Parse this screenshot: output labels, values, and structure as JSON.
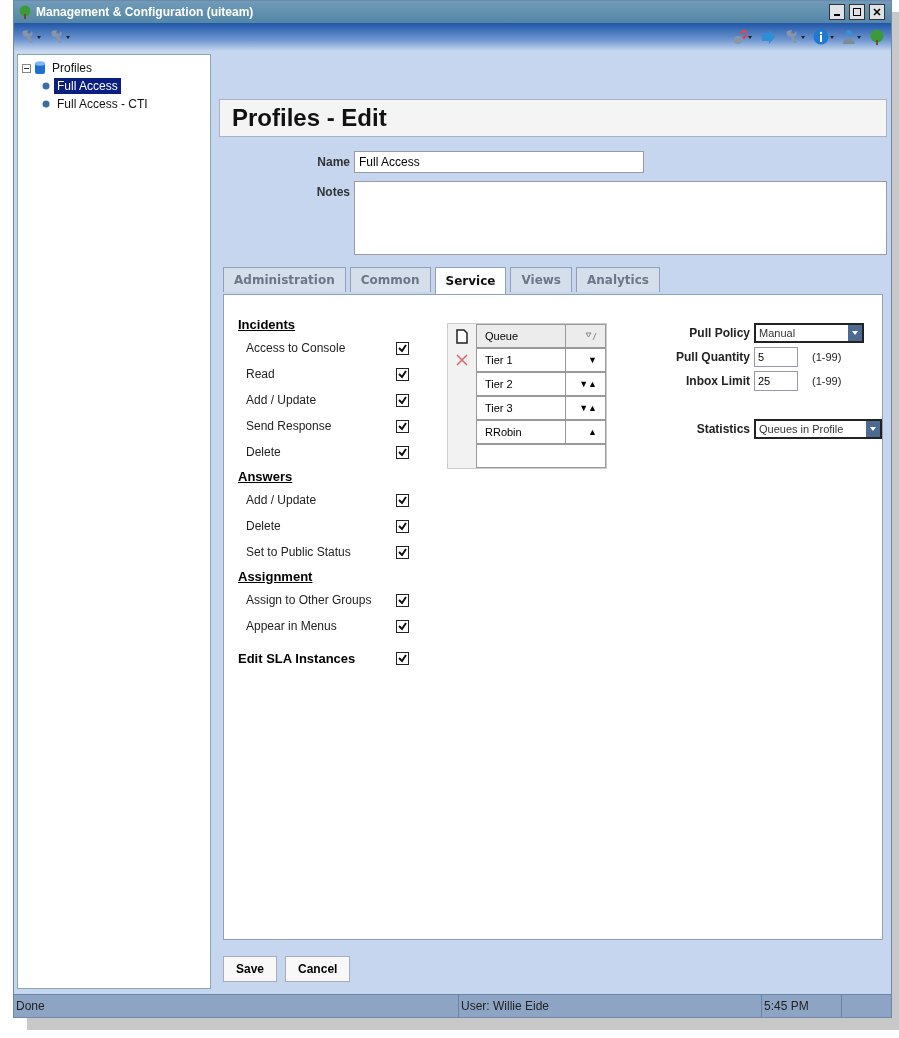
{
  "window": {
    "title": "Management & Configuration (uiteam)"
  },
  "tree": {
    "label": "Profiles",
    "expanded": true,
    "children": [
      {
        "label": "Full Access",
        "selected": true
      },
      {
        "label": "Full Access - CTI",
        "selected": false
      }
    ]
  },
  "page_title": "Profiles - Edit",
  "form": {
    "name_label": "Name",
    "name_value": "Full Access",
    "notes_label": "Notes"
  },
  "tabs": [
    {
      "label": "Administration",
      "selected": false
    },
    {
      "label": "Common",
      "selected": false
    },
    {
      "label": "Service",
      "selected": true
    },
    {
      "label": "Views",
      "selected": false
    },
    {
      "label": "Analytics",
      "selected": false
    }
  ],
  "permissions": [
    {
      "kind": "heading",
      "label": "Incidents"
    },
    {
      "kind": "checkbox",
      "label": "Access to Console",
      "checked": true
    },
    {
      "kind": "checkbox",
      "label": "Read",
      "checked": true
    },
    {
      "kind": "checkbox",
      "label": "Add / Update",
      "checked": true
    },
    {
      "kind": "checkbox",
      "label": "Send Response",
      "checked": true
    },
    {
      "kind": "checkbox",
      "label": "Delete",
      "checked": true
    },
    {
      "kind": "heading",
      "label": "Answers"
    },
    {
      "kind": "checkbox",
      "label": "Add / Update",
      "checked": true
    },
    {
      "kind": "checkbox",
      "label": "Delete",
      "checked": true
    },
    {
      "kind": "checkbox",
      "label": "Set to Public Status",
      "checked": true
    },
    {
      "kind": "heading",
      "label": "Assignment"
    },
    {
      "kind": "checkbox",
      "label": "Assign to Other Groups",
      "checked": true
    },
    {
      "kind": "checkbox",
      "label": "Appear in Menus",
      "checked": true
    },
    {
      "kind": "bold_checkbox",
      "label": "Edit SLA Instances",
      "checked": true
    }
  ],
  "queues": {
    "column": "Queue",
    "rows": [
      {
        "name": "Tier 1",
        "arrows": "▼"
      },
      {
        "name": "Tier 2",
        "arrows": "▼▲"
      },
      {
        "name": "Tier 3",
        "arrows": "▼▲"
      },
      {
        "name": "RRobin",
        "arrows": "▲"
      }
    ]
  },
  "settings": [
    {
      "kind": "select",
      "label": "Pull Policy",
      "value": "Manual"
    },
    {
      "kind": "number",
      "label": "Pull Quantity",
      "value": "5",
      "range": "(1-99)"
    },
    {
      "kind": "number",
      "label": "Inbox Limit",
      "value": "25",
      "range": "(1-99)"
    },
    {
      "kind": "select",
      "label": "Statistics",
      "value": "Queues in Profile"
    }
  ],
  "buttons": [
    "Save",
    "Cancel"
  ],
  "status_bar": {
    "status": "Done",
    "user": "User: Willie Eide",
    "time": "5:45 PM"
  }
}
